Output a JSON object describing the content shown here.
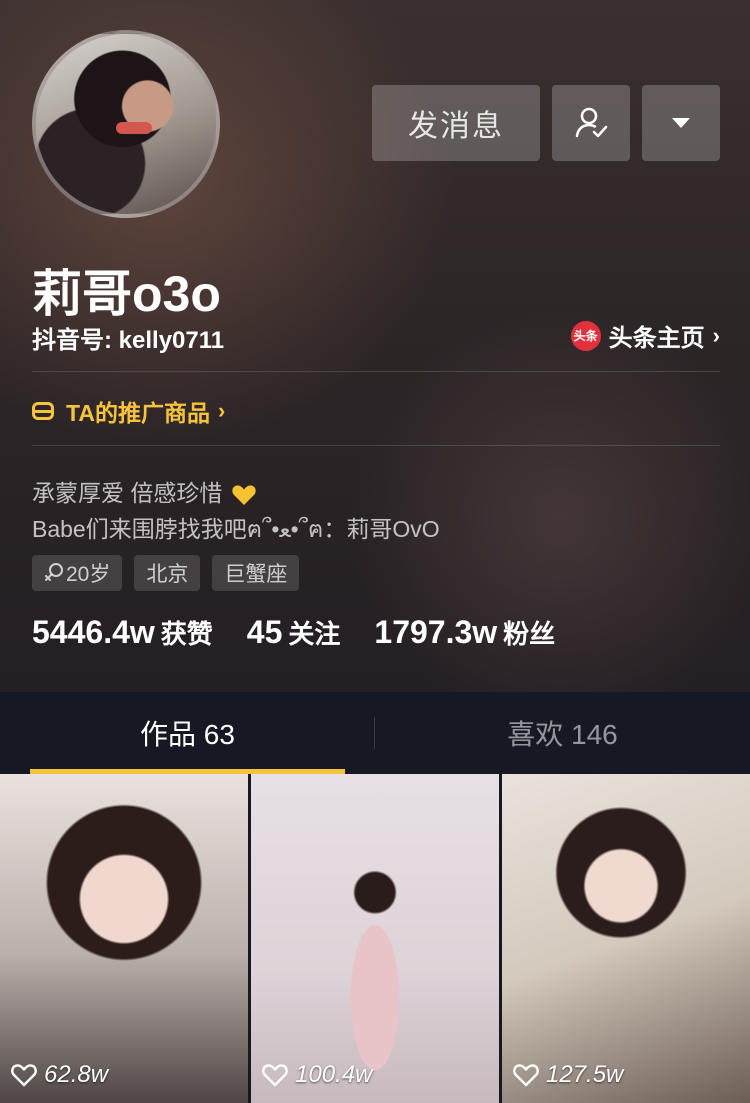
{
  "profile": {
    "name": "莉哥o3o",
    "douyin_id": "抖音号: kelly0711",
    "toutiao_link": "头条主页",
    "toutiao_logo": "头条"
  },
  "actions": {
    "message_label": "发消息"
  },
  "promo": {
    "label": "TA的推广商品"
  },
  "bio": {
    "line1": "承蒙厚爱 倍感珍惜",
    "line2": "Babe们来围脖找我吧ฅ՞•ﻌ•՞ฅ：莉哥OvO"
  },
  "tags": [
    "20岁",
    "北京",
    "巨蟹座"
  ],
  "stats": [
    {
      "value": "5446.4w",
      "label": "获赞"
    },
    {
      "value": "45",
      "label": "关注"
    },
    {
      "value": "1797.3w",
      "label": "粉丝"
    }
  ],
  "tabs": {
    "works": "作品 63",
    "likes": "喜欢 146"
  },
  "videos": [
    {
      "likes": "62.8w"
    },
    {
      "likes": "100.4w"
    },
    {
      "likes": "127.5w"
    }
  ],
  "colors": {
    "accent": "#f6c43c",
    "background": "#161823",
    "toutiao_red": "#e1323c"
  },
  "icons": {
    "follow": "user-check-icon",
    "more": "caret-down-icon",
    "promo": "shopping-bag-icon",
    "age": "female-icon",
    "likes": "heart-icon"
  }
}
